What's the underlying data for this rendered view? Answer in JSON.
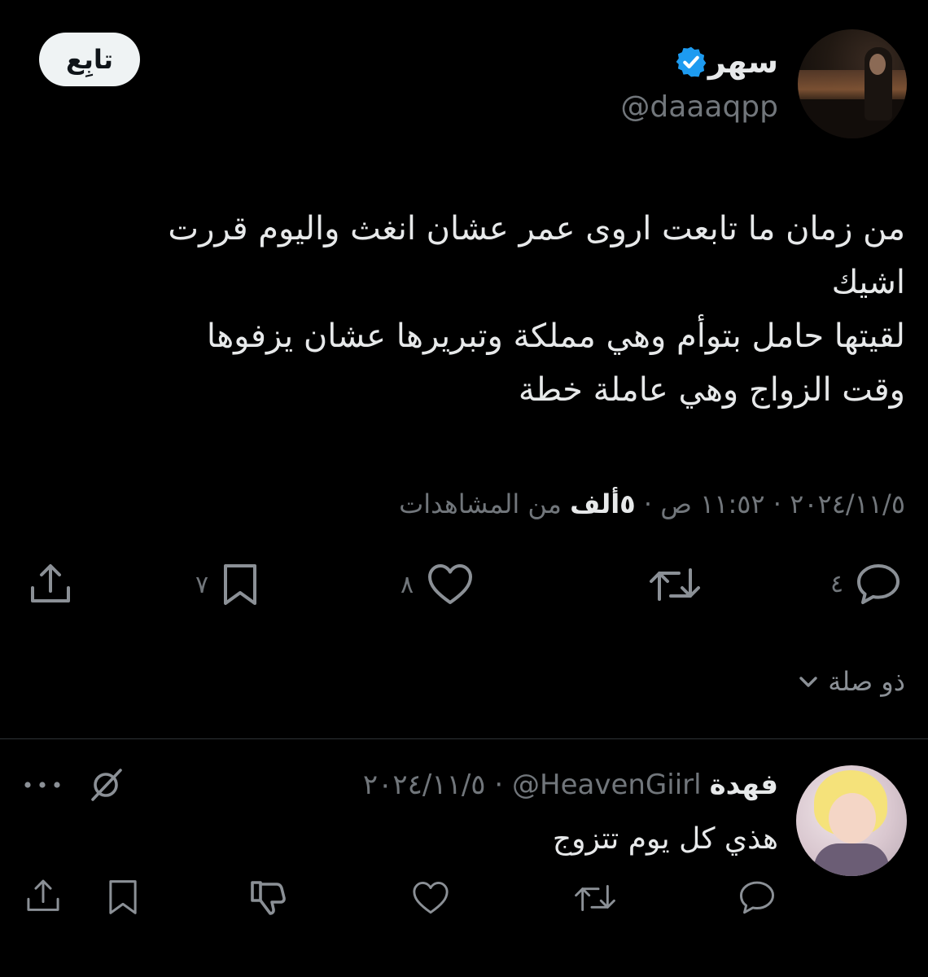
{
  "tweet": {
    "display_name": "سهر",
    "handle": "@daaaqpp",
    "follow_label": "تابِع",
    "text": "من زمان ما تابعت اروى عمر عشان انغث واليوم قررت\nاشيك\nلقيتها حامل بتوأم وهي مملكة وتبريرها عشان يزفوها\nوقت الزواج وهي عاملة خطة",
    "date": "٢٠٢٤/١١/٥",
    "time": "١١:٥٢ ص",
    "views_count": "٥ألف",
    "views_label": "من المشاهدات",
    "separator": " · ",
    "actions": {
      "reply_count": "٤",
      "like_count": "٨",
      "bookmark_count": "٧"
    }
  },
  "related_label": "ذو صلة",
  "reply": {
    "display_name": "فهدة",
    "handle": "@HeavenGiirl",
    "date": "٢٠٢٤/١١/٥",
    "text": "هذي كل يوم تتزوج"
  },
  "icons": {
    "verified": "verified-badge-icon",
    "reply": "reply-icon",
    "retweet": "retweet-icon",
    "like": "heart-icon",
    "bookmark": "bookmark-icon",
    "share": "share-icon",
    "dislike": "dislike-icon",
    "grok": "grok-icon",
    "more": "more-icon",
    "chevron": "chevron-down-icon"
  },
  "colors": {
    "background": "#000000",
    "text": "#e7e9ea",
    "secondary": "#71767b",
    "verified": "#1d9bf0",
    "follow_bg": "#eff3f4"
  }
}
